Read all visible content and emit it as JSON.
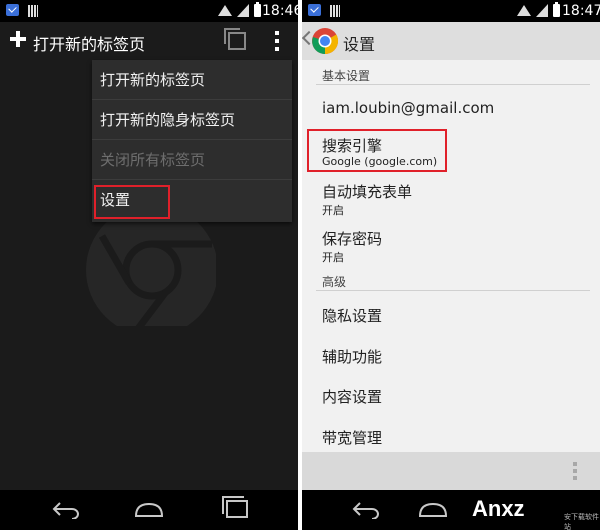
{
  "left_screen": {
    "status_bar": {
      "time": "18:46"
    },
    "action_bar": {
      "title": "打开新的标签页",
      "icons": [
        "plus-icon",
        "tabs-icon",
        "overflow-menu-icon"
      ]
    },
    "menu": {
      "items": [
        {
          "label": "打开新的标签页",
          "enabled": true
        },
        {
          "label": "打开新的隐身标签页",
          "enabled": true
        },
        {
          "label": "关闭所有标签页",
          "enabled": false
        },
        {
          "label": "设置",
          "enabled": true,
          "highlighted": true
        }
      ]
    },
    "background_logo": "chrome-logo-icon"
  },
  "right_screen": {
    "status_bar": {
      "time": "18:47"
    },
    "action_bar": {
      "title": "设置",
      "icons": [
        "back-chevron-icon",
        "chrome-logo-icon"
      ]
    },
    "sections": [
      {
        "header": "基本设置",
        "rows": [
          {
            "title": "iam.loubin@gmail.com",
            "subtitle": ""
          },
          {
            "title": "搜索引擎",
            "subtitle": "Google (google.com)",
            "highlighted": true
          },
          {
            "title": "自动填充表单",
            "subtitle": "开启"
          },
          {
            "title": "保存密码",
            "subtitle": "开启"
          }
        ]
      },
      {
        "header": "高级",
        "rows": [
          {
            "title": "隐私设置"
          },
          {
            "title": "辅助功能"
          },
          {
            "title": "内容设置"
          },
          {
            "title": "带宽管理"
          }
        ]
      }
    ]
  },
  "nav_icons": [
    "back-icon",
    "home-icon",
    "recents-icon"
  ],
  "watermark": {
    "text": "Anxz",
    "small_text": "安下载软件站"
  },
  "colors": {
    "highlight_border": "#e0202a",
    "dark_bg": "#1b1b1b",
    "menu_bg": "#2d2d2d",
    "settings_bg": "#f1f1f1"
  }
}
